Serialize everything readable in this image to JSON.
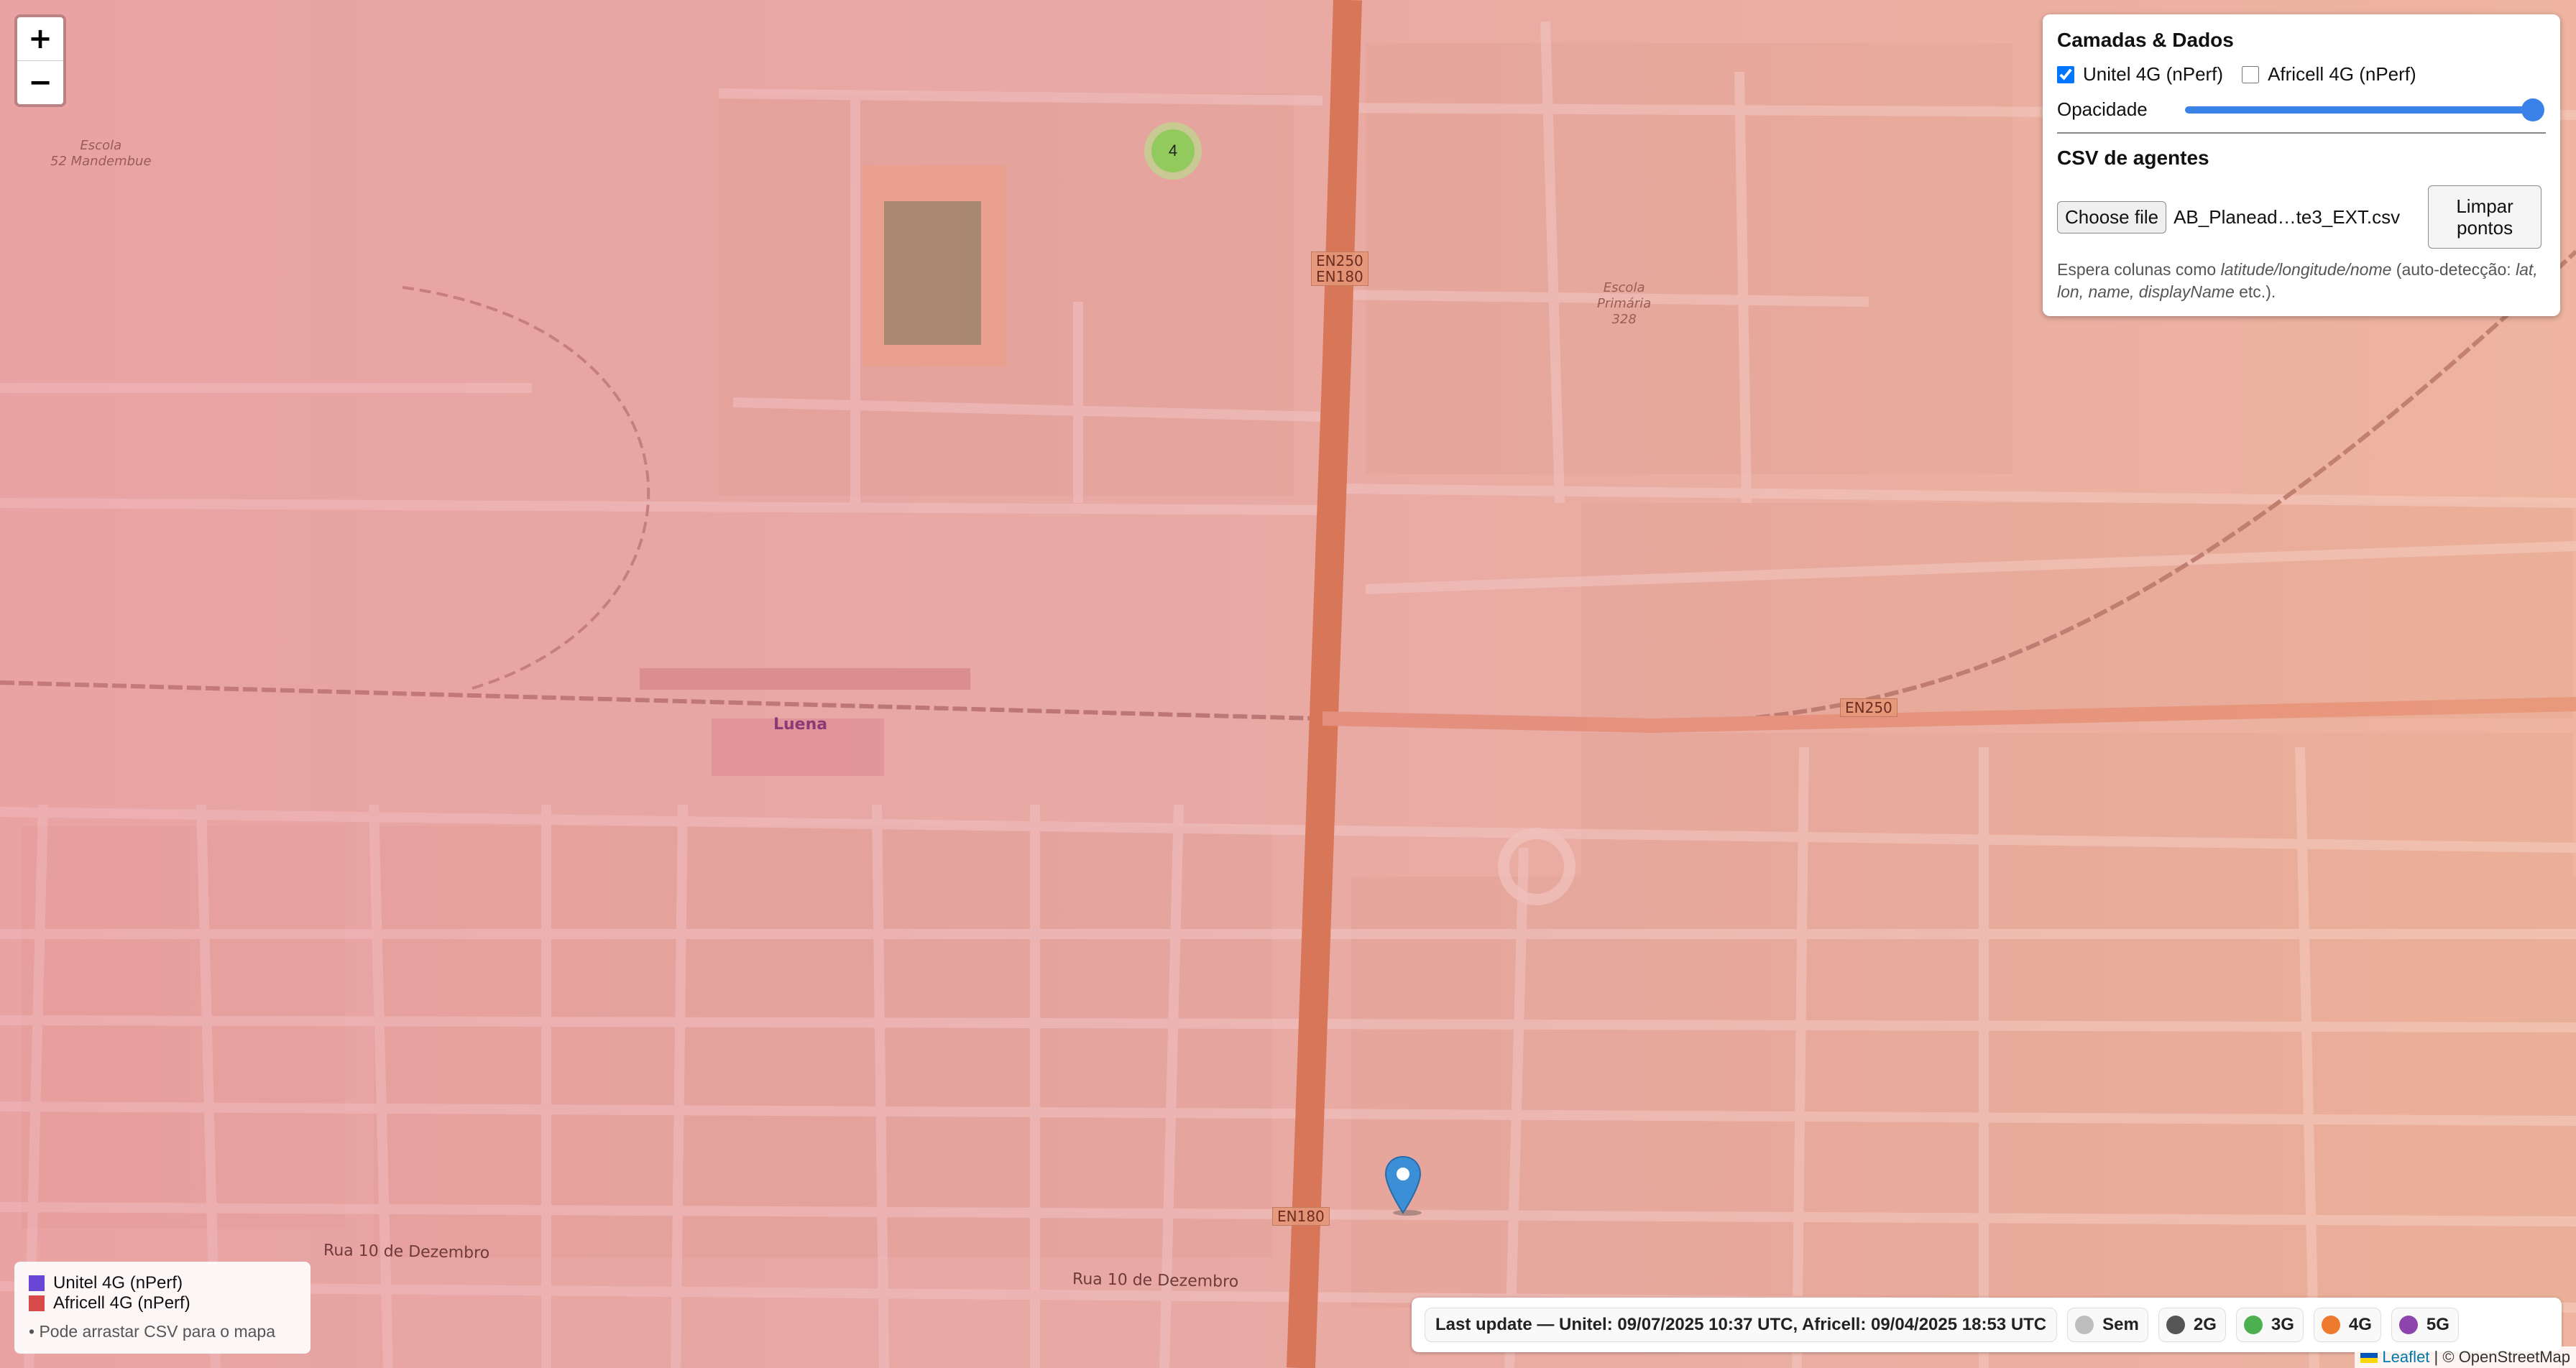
{
  "zoom": {
    "in_label": "+",
    "out_label": "−"
  },
  "map": {
    "places": {
      "school1": "Escola\n52 Mandembue",
      "school2": "Escola\nPrimária\n328",
      "city": "Luena"
    },
    "roads": {
      "en250_en180": "EN250\nEN180",
      "en250": "EN250",
      "en180": "EN180",
      "rua10_a": "Rua 10 de Dezembro",
      "rua10_b": "Rua 10 de Dezembro"
    },
    "cluster_count": "4",
    "marker_icon": "map-pin-icon"
  },
  "panel": {
    "title": "Camadas & Dados",
    "layers": [
      {
        "label": "Unitel 4G (nPerf)",
        "checked": true
      },
      {
        "label": "Africell 4G (nPerf)",
        "checked": false
      }
    ],
    "opacity_label": "Opacidade",
    "opacity_value": 1.0,
    "csv_title": "CSV de agentes",
    "choose_file_label": "Choose file",
    "file_name": "AB_Planead…te3_EXT.csv",
    "clear_label": "Limpar pontos",
    "hint_prefix": "Espera colunas como ",
    "hint_cols": "latitude/longitude/nome",
    "hint_mid": " (auto-detecção: ",
    "hint_alias": "lat, lon, name, displayName",
    "hint_suffix": " etc.)."
  },
  "legend": {
    "items": [
      {
        "label": "Unitel 4G (nPerf)",
        "color": "#6a46d6"
      },
      {
        "label": "Africell 4G (nPerf)",
        "color": "#d84a4a"
      }
    ],
    "note": "• Pode arrastar CSV para o mapa"
  },
  "status": {
    "last_update": "Last update — Unitel: 09/07/2025 10:37 UTC, Africell: 09/04/2025 18:53 UTC",
    "coverage": [
      {
        "label": "Sem",
        "color": "#bdbdbd"
      },
      {
        "label": "2G",
        "color": "#555555"
      },
      {
        "label": "3G",
        "color": "#4caf50"
      },
      {
        "label": "4G",
        "color": "#ee7a30"
      },
      {
        "label": "5G",
        "color": "#8e44ad"
      }
    ]
  },
  "attribution": {
    "leaflet": "Leaflet",
    "separator": " | © ",
    "osm": "OpenStreetMap"
  }
}
